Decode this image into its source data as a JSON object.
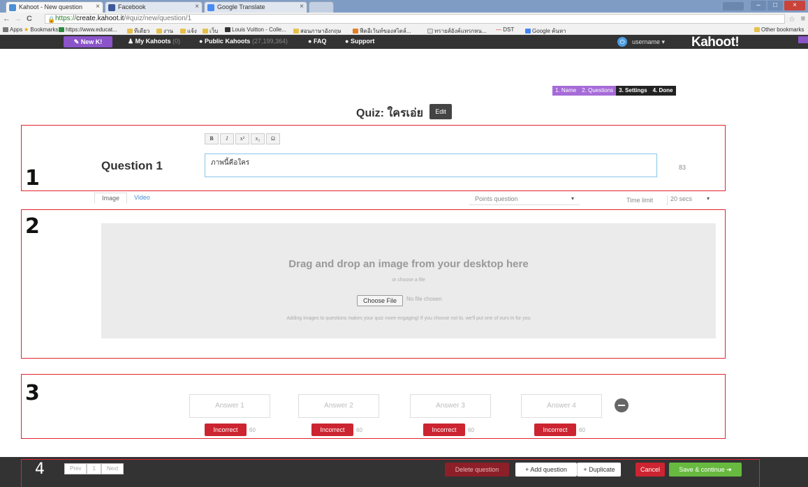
{
  "browser": {
    "tabs": [
      {
        "label": "Kahoot - New question",
        "color": "#4b8fd6"
      },
      {
        "label": "Facebook",
        "color": "#3b5998"
      },
      {
        "label": "Google Translate",
        "color": "#4a8af4"
      }
    ],
    "url_scheme": "https://",
    "url_host": "create.kahoot.it",
    "url_path": "/#quiz/new/question/1",
    "bookmarks": [
      "Apps",
      "Bookmarks",
      "https://www.educat...",
      "ทีเดียว",
      "งาน",
      "แจ้ง",
      "เว็บ",
      "Louis Vuitton - Colle...",
      "สอนภาษาอังกฤษ",
      "ฟีดอีเว้นท์ของสไตล์...",
      "ทรายส์อังค์แทรกหน...",
      "DST",
      "Google ค้นหา",
      "Other bookmarks"
    ]
  },
  "navbar": {
    "new_label": "New K!",
    "my_kahoots": "My Kahoots",
    "my_kahoots_count": "(0)",
    "public_kahoots": "Public Kahoots",
    "public_kahoots_count": "(27,199,364)",
    "faq": "FAQ",
    "support": "Support",
    "username": "username",
    "logo": "Kahoot!"
  },
  "steps": [
    {
      "label": "1. Name",
      "state": "done"
    },
    {
      "label": "2. Questions",
      "state": "done"
    },
    {
      "label": "3. Settings",
      "state": "todo"
    },
    {
      "label": "4. Done",
      "state": "todo"
    }
  ],
  "quiz": {
    "title": "Quiz: ใครเอ่ย",
    "edit_label": "Edit"
  },
  "annotations": [
    "1",
    "2",
    "3",
    "4"
  ],
  "question": {
    "label": "Question 1",
    "text": "ภาพนี้คือใคร",
    "char_count": "83",
    "format_buttons": [
      "B",
      "I",
      "x²",
      "x₂",
      "Ω"
    ]
  },
  "media": {
    "tabs": [
      "Image",
      "Video"
    ],
    "points_label": "Points question",
    "time_limit_label": "Time limit",
    "time_limit_value": "20 secs"
  },
  "dropzone": {
    "title": "Drag and drop an image from your desktop here",
    "or_text": "or choose a file",
    "choose_label": "Choose File",
    "no_file_text": "No file chosen",
    "hint": "Adding images to questions makes your quiz more engaging! If you choose not to, we'll put one of ours in for you"
  },
  "answers": [
    {
      "placeholder": "Answer 1",
      "status": "Incorrect",
      "count": "60"
    },
    {
      "placeholder": "Answer 2",
      "status": "Incorrect",
      "count": "60"
    },
    {
      "placeholder": "Answer 3",
      "status": "Incorrect",
      "count": "60"
    },
    {
      "placeholder": "Answer 4",
      "status": "Incorrect",
      "count": "60"
    }
  ],
  "footer": {
    "prev": "Prev",
    "page": "1",
    "next": "Next",
    "delete": "Delete question",
    "add": "+ Add question",
    "duplicate": "+ Duplicate",
    "cancel": "Cancel",
    "save": "Save & continue ➜"
  },
  "colors": {
    "annotation_red": "#e0242e",
    "kahoot_purple": "#8b54c9",
    "incorrect_red": "#cc2430",
    "save_green": "#67b93f"
  }
}
